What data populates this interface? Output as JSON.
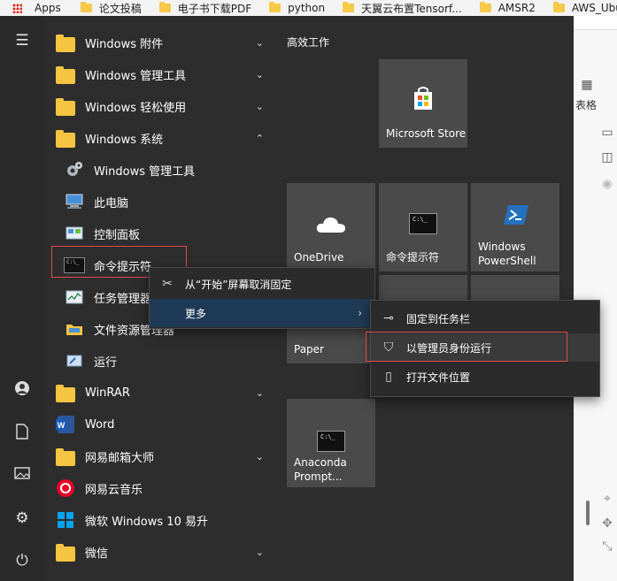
{
  "bookmarks": [
    {
      "label": "Apps",
      "icon": "apps-grid-icon"
    },
    {
      "label": "论文投稿",
      "icon": "folder-icon"
    },
    {
      "label": "电子书下载PDF",
      "icon": "folder-icon"
    },
    {
      "label": "python",
      "icon": "folder-icon"
    },
    {
      "label": "天翼云布置Tensorf...",
      "icon": "folder-icon"
    },
    {
      "label": "AMSR2",
      "icon": "folder-icon"
    },
    {
      "label": "AWS_Ubu",
      "icon": "folder-icon"
    }
  ],
  "right_window": {
    "table_label": "表格"
  },
  "app_list": {
    "items": [
      {
        "label": "Windows 附件",
        "type": "folder",
        "expanded": false
      },
      {
        "label": "Windows 管理工具",
        "type": "folder",
        "expanded": false
      },
      {
        "label": "Windows 轻松使用",
        "type": "folder",
        "expanded": false
      },
      {
        "label": "Windows 系统",
        "type": "folder",
        "expanded": true
      },
      {
        "label": "Windows 管理工具",
        "type": "app",
        "icon": "admin-tools-icon"
      },
      {
        "label": "此电脑",
        "type": "app",
        "icon": "computer-icon"
      },
      {
        "label": "控制面板",
        "type": "app",
        "icon": "control-panel-icon"
      },
      {
        "label": "命令提示符",
        "type": "app",
        "icon": "cmd-icon"
      },
      {
        "label": "任务管理器",
        "type": "app",
        "icon": "task-manager-icon"
      },
      {
        "label": "文件资源管理器",
        "type": "app",
        "icon": "file-explorer-icon"
      },
      {
        "label": "运行",
        "type": "app",
        "icon": "run-icon"
      },
      {
        "label": "WinRAR",
        "type": "folder",
        "expanded": false
      },
      {
        "label": "Word",
        "type": "app",
        "icon": "word-icon"
      },
      {
        "label": "网易邮箱大师",
        "type": "folder",
        "expanded": false
      },
      {
        "label": "网易云音乐",
        "type": "app",
        "icon": "netease-music-icon"
      },
      {
        "label": "微软 Windows 10 易升",
        "type": "app",
        "icon": "windows-logo-icon"
      },
      {
        "label": "微信",
        "type": "folder",
        "expanded": false
      }
    ]
  },
  "tiles": {
    "section_title": "高效工作",
    "items": [
      {
        "label": "Microsoft Store",
        "icon": "store-icon"
      },
      {
        "label": "OneDrive",
        "icon": "onedrive-icon"
      },
      {
        "label": "命令提示符",
        "icon": "cmd-icon"
      },
      {
        "label": "Windows PowerShell",
        "icon": "powershell-icon"
      },
      {
        "label": "Paper",
        "icon": ""
      },
      {
        "label": "Anaconda Prompt...",
        "icon": "cmd-icon"
      }
    ]
  },
  "context_menu": {
    "items": [
      {
        "label": "从“开始”屏幕取消固定",
        "icon": "unpin-icon"
      },
      {
        "label": "更多",
        "icon": "",
        "has_submenu": true
      }
    ]
  },
  "submenu": {
    "items": [
      {
        "label": "固定到任务栏",
        "icon": "pin-icon"
      },
      {
        "label": "以管理员身份运行",
        "icon": "shield-run-icon"
      },
      {
        "label": "打开文件位置",
        "icon": "open-file-location-icon"
      }
    ]
  },
  "colors": {
    "menu_bg": "#2d2d2d",
    "tile_bg": "#4a4a4a",
    "highlight": "#e34a4a",
    "selection": "#3a3a3a",
    "hover_blue": "#1f3a56"
  }
}
